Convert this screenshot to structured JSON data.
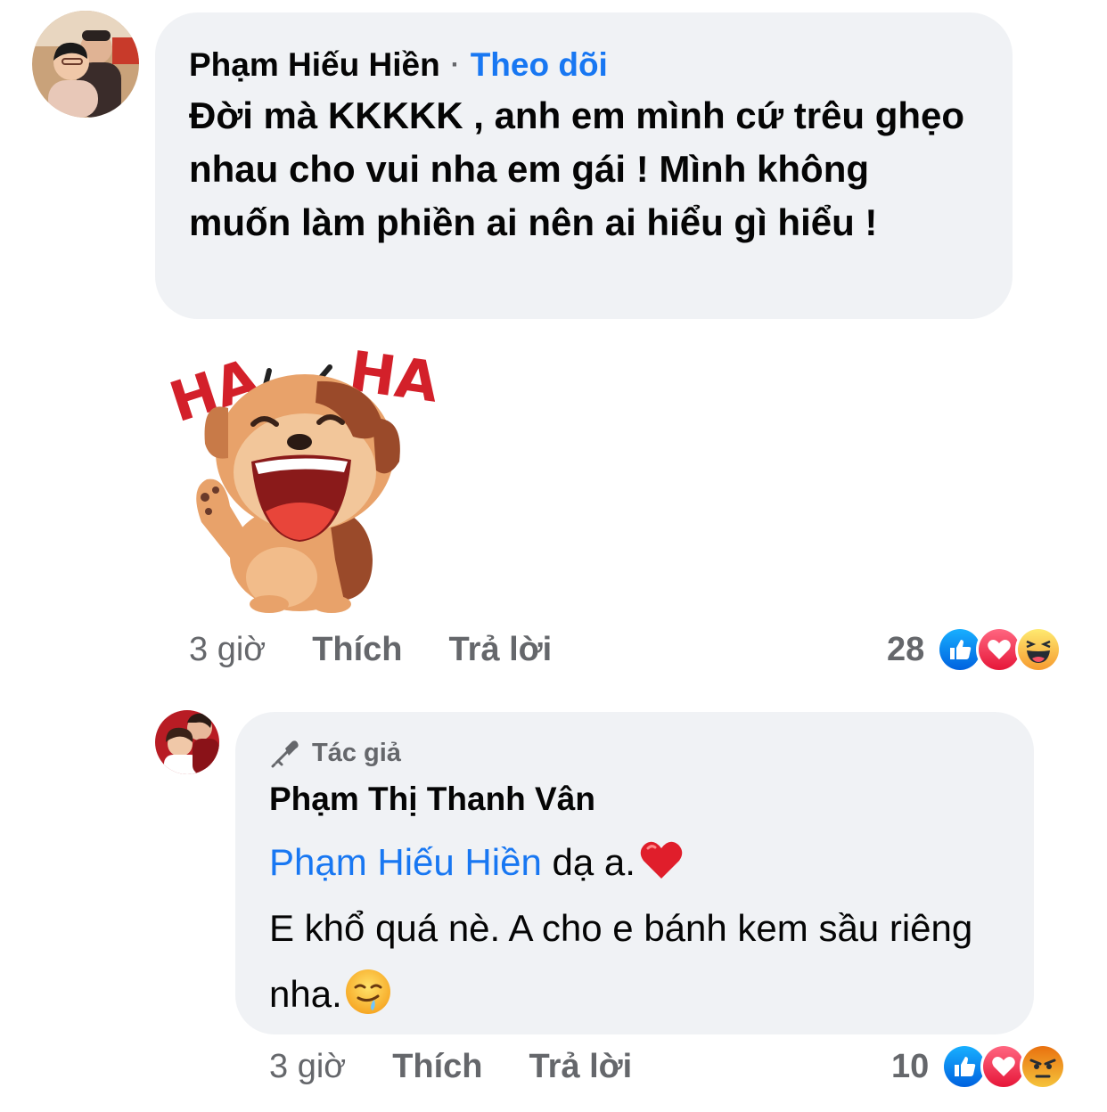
{
  "comment": {
    "author": "Phạm Hiếu Hiền",
    "separator": "·",
    "follow_label": "Theo dõi",
    "text": "Đời mà KKKKK , anh em mình cứ trêu ghẹo nhau cho vui nha em gái ! Mình không muốn làm phiền ai nên ai hiểu gì hiểu !",
    "sticker": {
      "icon": "laughing-dog-haha-sticker",
      "label_left": "HA",
      "label_right": "HA"
    },
    "time": "3 giờ",
    "like_label": "Thích",
    "reply_label": "Trả lời",
    "reaction_count": "28",
    "reactions": [
      "like-reaction-icon",
      "love-reaction-icon",
      "haha-reaction-icon"
    ]
  },
  "reply": {
    "badge_label": "Tác giả",
    "author": "Phạm Thị Thanh Vân",
    "mention": "Phạm Hiếu Hiền",
    "text_line1": "dạ a.",
    "text_line2": "E khổ quá nè. A cho e bánh kem sầu riêng nha.",
    "emoji_1": "red-heart-emoji",
    "emoji_2": "drooling-face-emoji",
    "time": "3 giờ",
    "like_label": "Thích",
    "reply_label": "Trả lời",
    "reaction_count": "10",
    "reactions": [
      "like-reaction-icon",
      "love-reaction-icon",
      "angry-reaction-icon"
    ]
  },
  "colors": {
    "link": "#1877f2",
    "bubble": "#f0f2f5",
    "secondary_text": "#65676b"
  }
}
